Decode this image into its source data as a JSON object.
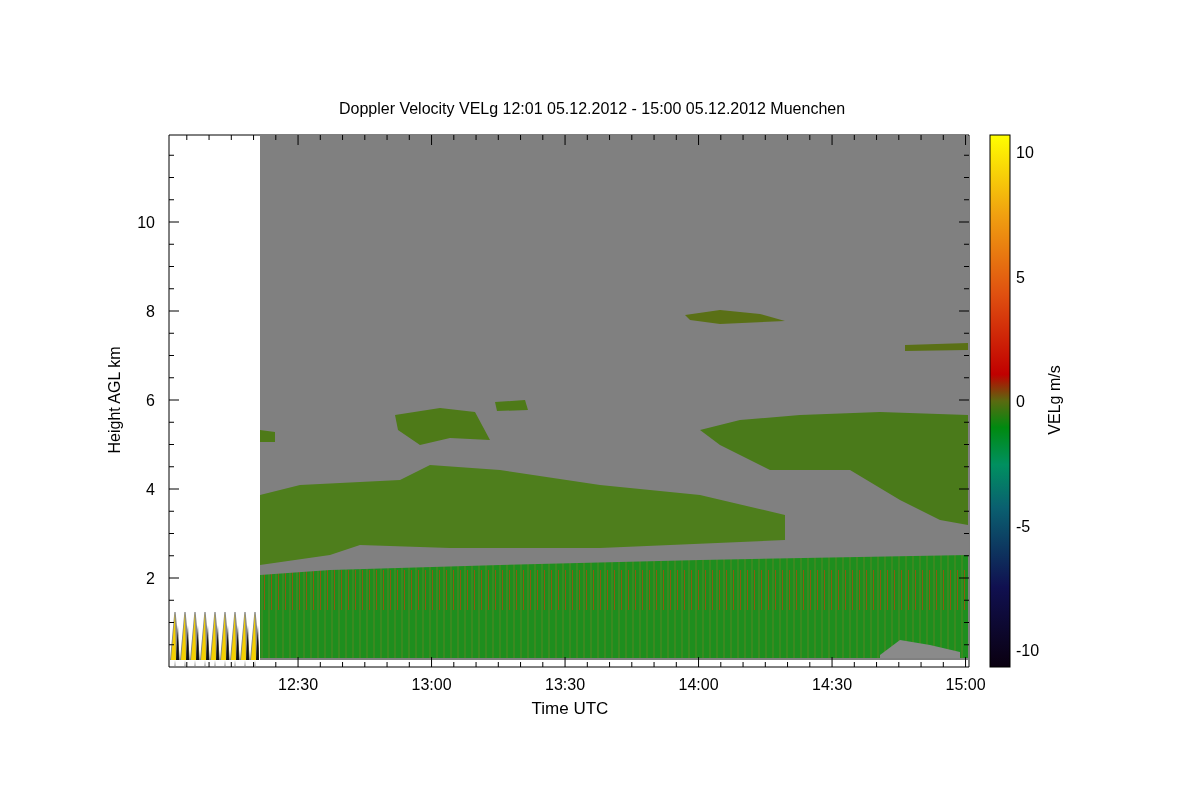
{
  "title": "Doppler Velocity VELg   12:01 05.12.2012 - 15:00 05.12.2012 Muenchen",
  "x_axis": {
    "label": "Time UTC",
    "ticks": [
      "12:30",
      "13:00",
      "13:30",
      "14:00",
      "14:30",
      "15:00"
    ]
  },
  "y_axis": {
    "label": "Height AGL km",
    "ticks": [
      "10",
      "8",
      "6",
      "4",
      "2"
    ]
  },
  "colorbar": {
    "label": "VELg m/s",
    "ticks": [
      "10",
      "5",
      "0",
      "-5",
      "-10"
    ]
  }
}
